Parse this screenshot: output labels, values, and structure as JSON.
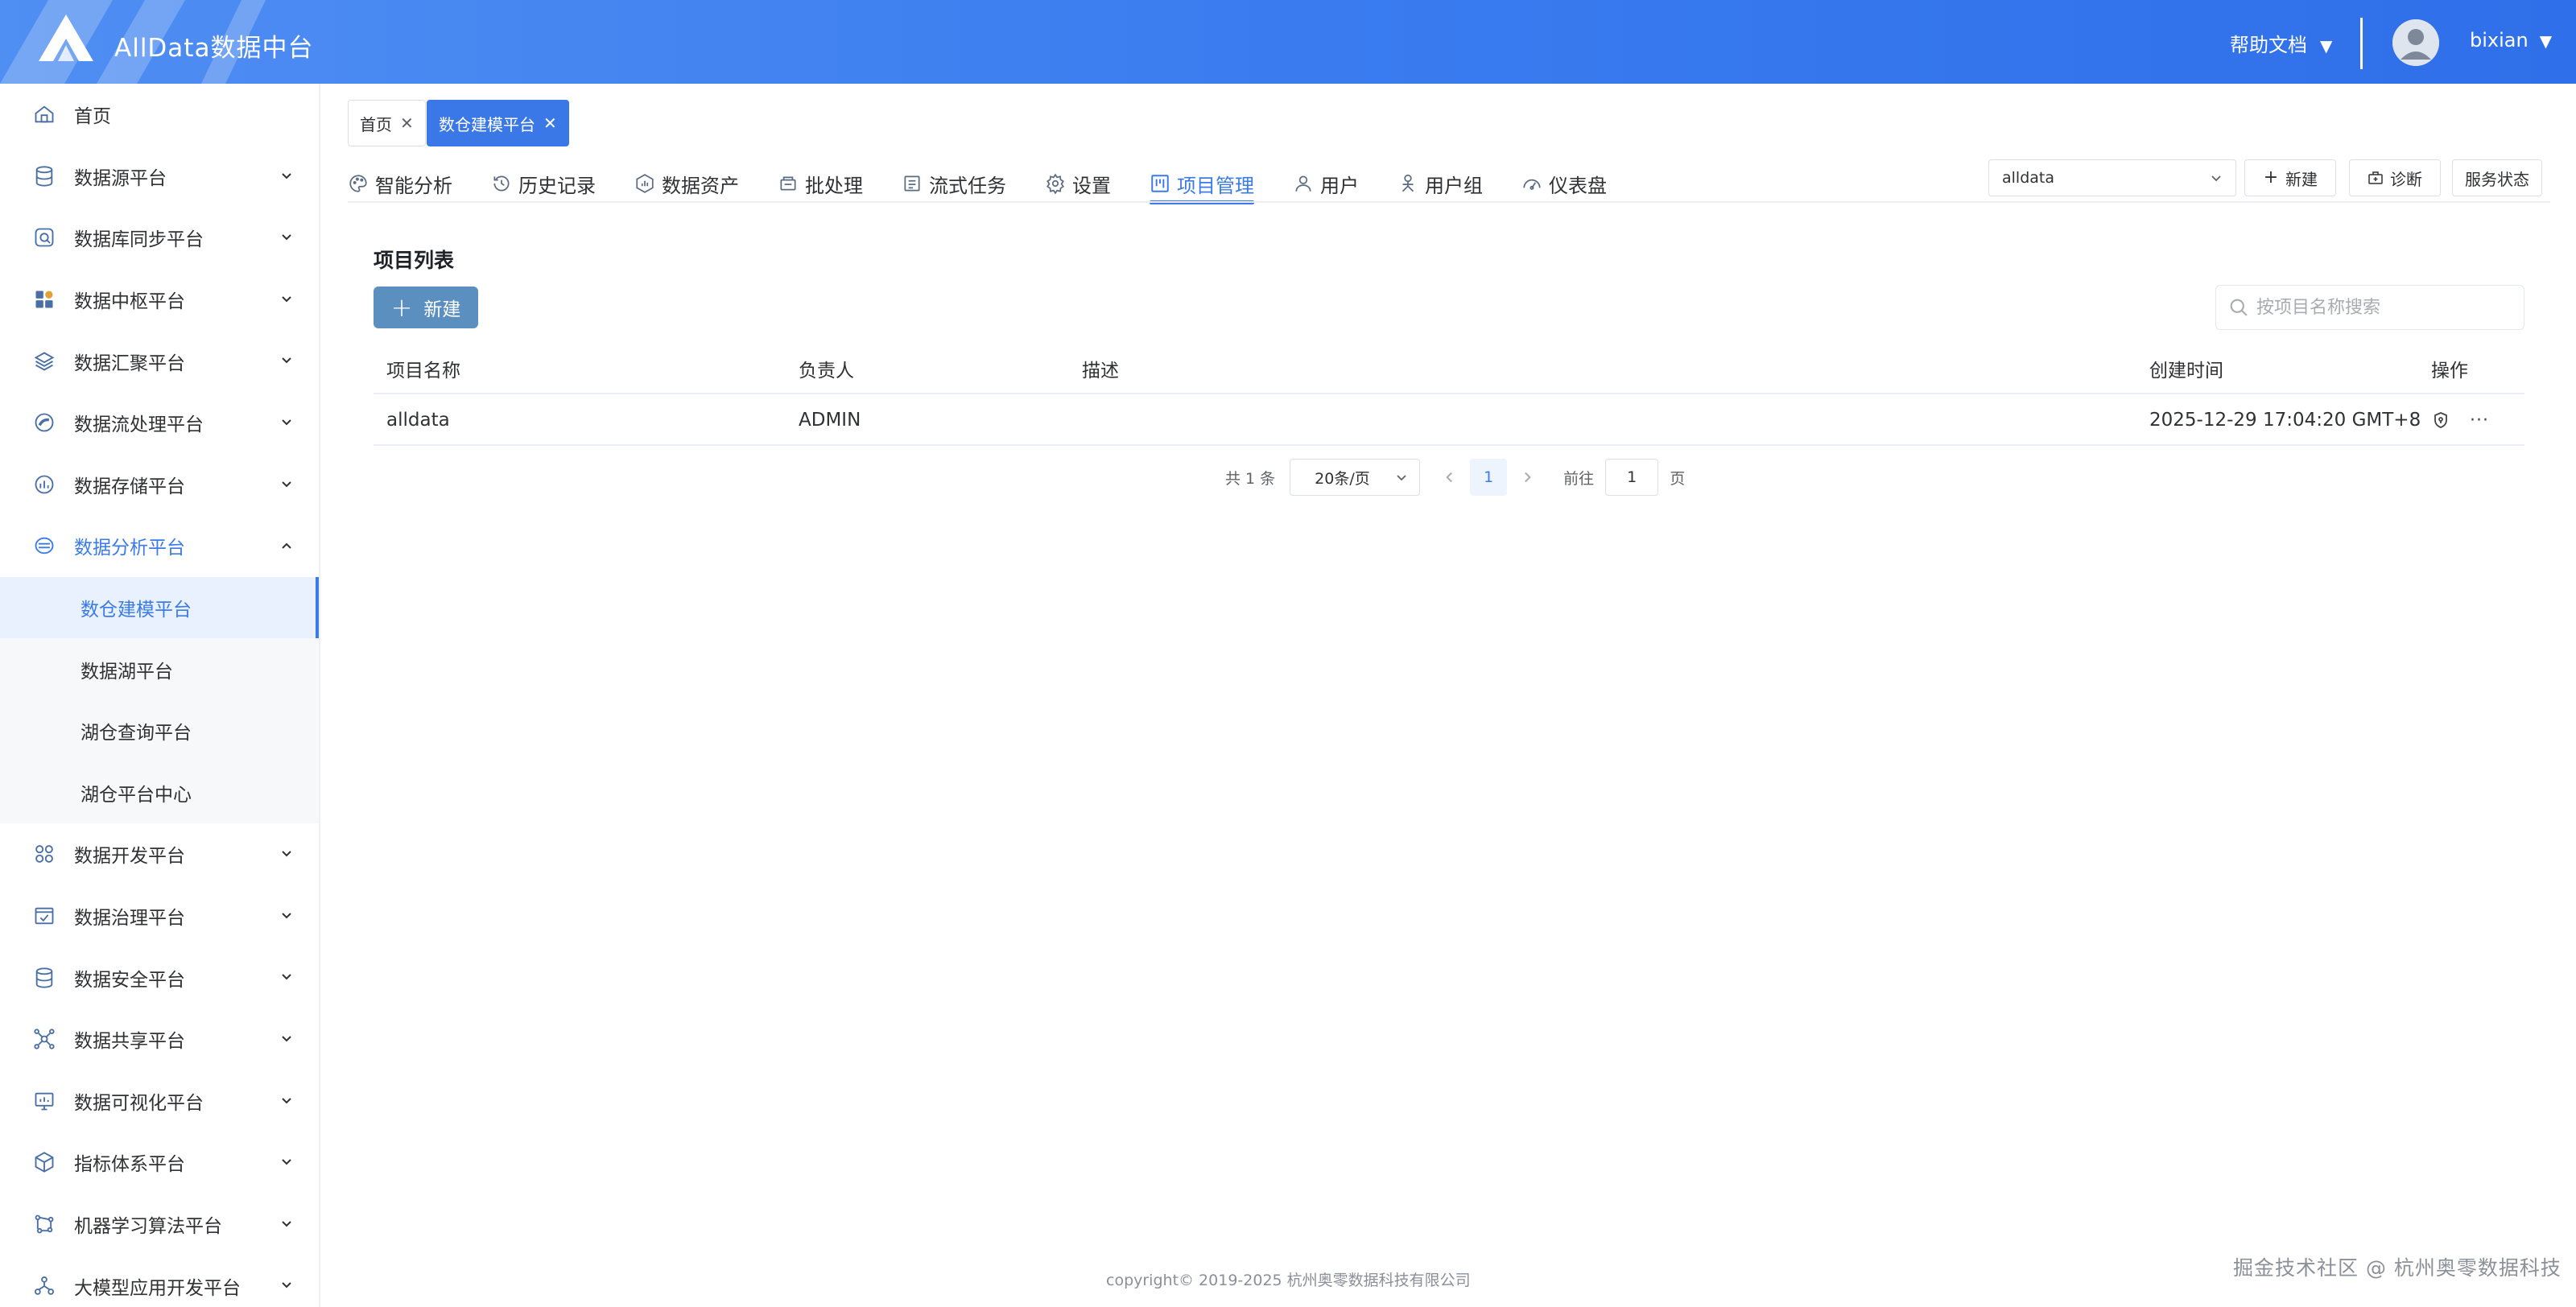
{
  "header": {
    "app_title": "AllData数据中台",
    "help_label": "帮助文档",
    "username": "bixian"
  },
  "sidebar": {
    "items": [
      {
        "label": "首页",
        "icon": "home-icon"
      },
      {
        "label": "数据源平台",
        "icon": "database-icon"
      },
      {
        "label": "数据库同步平台",
        "icon": "sync-icon"
      },
      {
        "label": "数据中枢平台",
        "icon": "grid-icon"
      },
      {
        "label": "数据汇聚平台",
        "icon": "layers-icon"
      },
      {
        "label": "数据流处理平台",
        "icon": "stream-icon"
      },
      {
        "label": "数据存储平台",
        "icon": "storage-icon"
      },
      {
        "label": "数据分析平台",
        "icon": "analysis-icon"
      }
    ],
    "sub_items": [
      {
        "label": "数仓建模平台"
      },
      {
        "label": "数据湖平台"
      },
      {
        "label": "湖仓查询平台"
      },
      {
        "label": "湖仓平台中心"
      }
    ],
    "items_after": [
      {
        "label": "数据开发平台",
        "icon": "dev-icon"
      },
      {
        "label": "数据治理平台",
        "icon": "governance-icon"
      },
      {
        "label": "数据安全平台",
        "icon": "security-icon"
      },
      {
        "label": "数据共享平台",
        "icon": "share-icon"
      },
      {
        "label": "数据可视化平台",
        "icon": "monitor-icon"
      },
      {
        "label": "指标体系平台",
        "icon": "cube-icon"
      },
      {
        "label": "机器学习算法平台",
        "icon": "ml-icon"
      },
      {
        "label": "大模型应用开发平台",
        "icon": "llm-icon"
      }
    ]
  },
  "tags": [
    {
      "label": "首页"
    },
    {
      "label": "数仓建模平台"
    }
  ],
  "module_nav": [
    {
      "label": "智能分析",
      "icon": "palette-icon"
    },
    {
      "label": "历史记录",
      "icon": "history-icon"
    },
    {
      "label": "数据资产",
      "icon": "asset-icon"
    },
    {
      "label": "批处理",
      "icon": "batch-icon"
    },
    {
      "label": "流式任务",
      "icon": "stream-task-icon"
    },
    {
      "label": "设置",
      "icon": "gear-icon"
    },
    {
      "label": "项目管理",
      "icon": "kanban-icon"
    },
    {
      "label": "用户",
      "icon": "user-icon"
    },
    {
      "label": "用户组",
      "icon": "user-group-icon"
    },
    {
      "label": "仪表盘",
      "icon": "dashboard-icon"
    }
  ],
  "toolbar": {
    "project_value": "alldata",
    "new_label": "新建",
    "diagnose_label": "诊断",
    "service_status_label": "服务状态"
  },
  "main": {
    "title": "项目列表",
    "new_button": "新建",
    "search_placeholder": "按项目名称搜索",
    "columns": [
      "项目名称",
      "负责人",
      "描述",
      "创建时间",
      "操作"
    ],
    "rows": [
      {
        "name": "alldata",
        "owner": "ADMIN",
        "desc": "",
        "created": "2025-12-29 17:04:20 GMT+8"
      }
    ]
  },
  "pager": {
    "total": "共 1 条",
    "page_size": "20条/页",
    "current": "1",
    "goto_label": "前往",
    "goto_value": "1",
    "page_suffix": "页"
  },
  "footer": {
    "copyright": "copyright© 2019-2025 杭州奥零数据科技有限公司",
    "watermark": "掘金技术社区 @ 杭州奥零数据科技"
  },
  "colors": {
    "primary": "#3b7be8",
    "header": "#3a7cf0",
    "new_button": "#5b8fc0"
  }
}
